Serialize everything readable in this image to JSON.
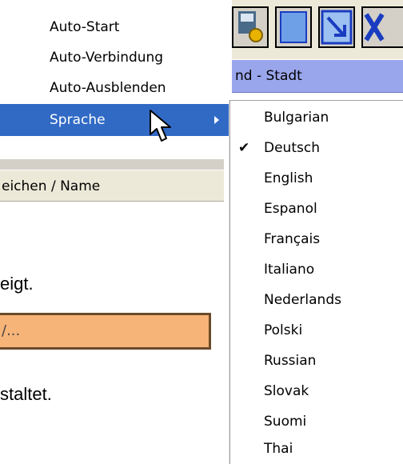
{
  "menu": {
    "items": [
      {
        "label": "Auto-Start"
      },
      {
        "label": "Auto-Verbindung"
      },
      {
        "label": "Auto-Ausblenden"
      },
      {
        "label": "Sprache"
      }
    ]
  },
  "submenu": {
    "items": [
      {
        "label": "Bulgarian",
        "checked": false
      },
      {
        "label": "Deutsch",
        "checked": true
      },
      {
        "label": "English",
        "checked": false
      },
      {
        "label": "Espanol",
        "checked": false
      },
      {
        "label": "Français",
        "checked": false
      },
      {
        "label": "Italiano",
        "checked": false
      },
      {
        "label": "Nederlands",
        "checked": false
      },
      {
        "label": "Polski",
        "checked": false
      },
      {
        "label": "Russian",
        "checked": false
      },
      {
        "label": "Slovak",
        "checked": false
      },
      {
        "label": "Suomi",
        "checked": false
      },
      {
        "label": "Thai",
        "checked": false
      }
    ],
    "check_glyph": "✔"
  },
  "background": {
    "stadt_label": "nd - Stadt",
    "column_header": "eichen / Name",
    "text_line1": "eigt.",
    "field_value": "/...",
    "text_line2": "staltet."
  },
  "colors": {
    "selection": "#316ac5",
    "stadt_bar": "#9aa6ec",
    "field": "#f7b479"
  }
}
